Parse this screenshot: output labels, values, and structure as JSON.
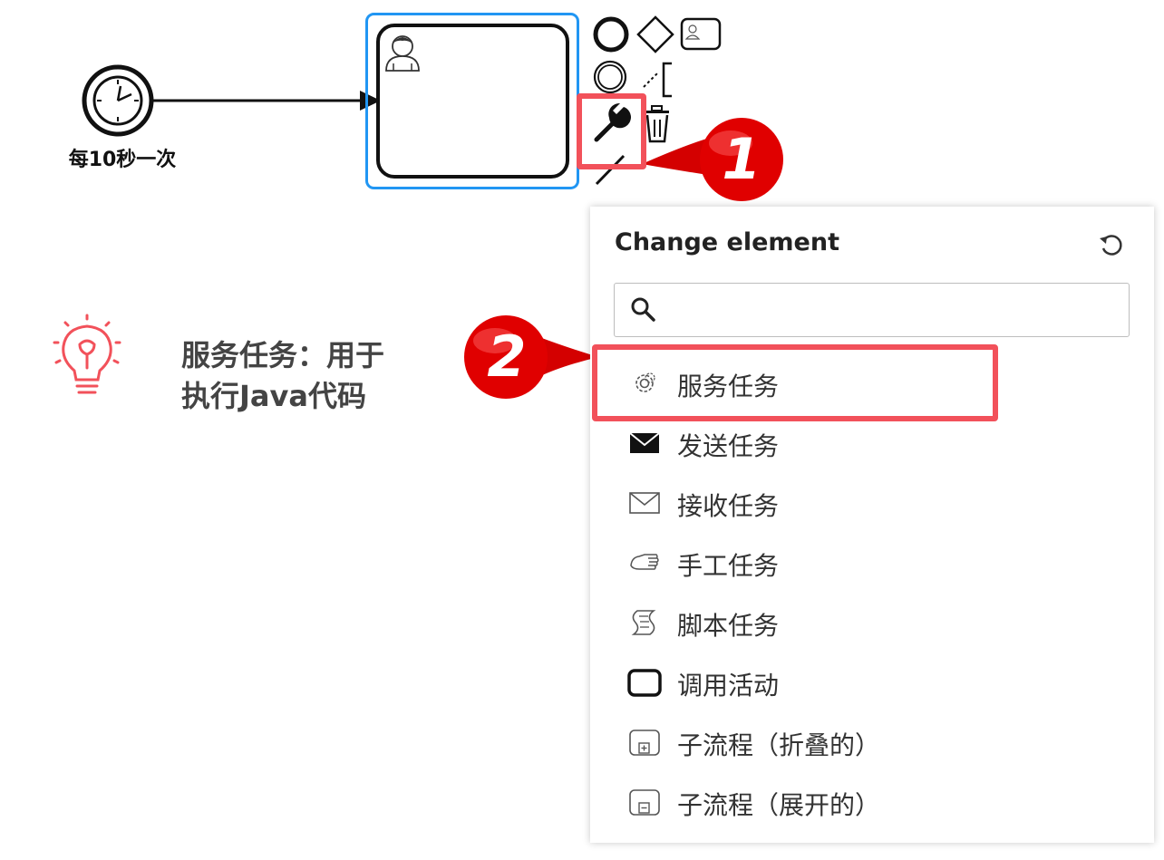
{
  "diagram": {
    "timer_event_label": "每10秒一次"
  },
  "tip": {
    "text_line1": "服务任务：用于",
    "text_line2": "执行Java代码"
  },
  "callouts": {
    "one": "1",
    "two": "2"
  },
  "popup": {
    "title": "Change element",
    "search": {
      "value": "",
      "placeholder": ""
    },
    "entries": [
      {
        "label": "服务任务",
        "icon": "gear-icon"
      },
      {
        "label": "发送任务",
        "icon": "envelope-filled-icon"
      },
      {
        "label": "接收任务",
        "icon": "envelope-outline-icon"
      },
      {
        "label": "手工任务",
        "icon": "hand-icon"
      },
      {
        "label": "脚本任务",
        "icon": "script-icon"
      },
      {
        "label": "调用活动",
        "icon": "call-activity-icon"
      },
      {
        "label": "子流程（折叠的）",
        "icon": "subprocess-collapsed-icon"
      },
      {
        "label": "子流程（展开的）",
        "icon": "subprocess-expanded-icon"
      }
    ]
  },
  "colors": {
    "selection_blue": "#2196f3",
    "highlight_red": "#f2515a",
    "callout_red": "#e00000"
  }
}
